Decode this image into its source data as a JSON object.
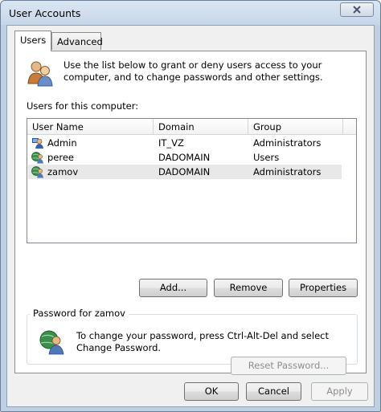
{
  "window": {
    "title": "User Accounts"
  },
  "tabs": [
    {
      "label": "Users",
      "active": true
    },
    {
      "label": "Advanced",
      "active": false
    }
  ],
  "users_tab": {
    "intro": "Use the list below to grant or deny users access to your computer, and to change passwords and other settings.",
    "list_label": "Users for this computer:",
    "columns": [
      "User Name",
      "Domain",
      "Group"
    ],
    "rows": [
      {
        "name": "Admin",
        "domain": "IT_VZ",
        "group": "Administrators",
        "icon": "admin-user-icon",
        "selected": false
      },
      {
        "name": "peree",
        "domain": "DADOMAIN",
        "group": "Users",
        "icon": "domain-user-icon",
        "selected": false
      },
      {
        "name": "zamov",
        "domain": "DADOMAIN",
        "group": "Administrators",
        "icon": "domain-user-icon",
        "selected": true
      }
    ],
    "buttons": {
      "add": "Add...",
      "remove": "Remove",
      "properties": "Properties"
    },
    "password_group": {
      "label": "Password for zamov",
      "text": "To change your password, press Ctrl-Alt-Del and select Change Password.",
      "reset_button": "Reset Password...",
      "reset_enabled": false
    }
  },
  "dialog_buttons": {
    "ok": "OK",
    "cancel": "Cancel",
    "apply": "Apply",
    "apply_enabled": false
  },
  "colors": {
    "window_frame": "#bfd0e3",
    "selected_row": "#e8e8e8",
    "disabled_text": "#8d8d8d"
  }
}
